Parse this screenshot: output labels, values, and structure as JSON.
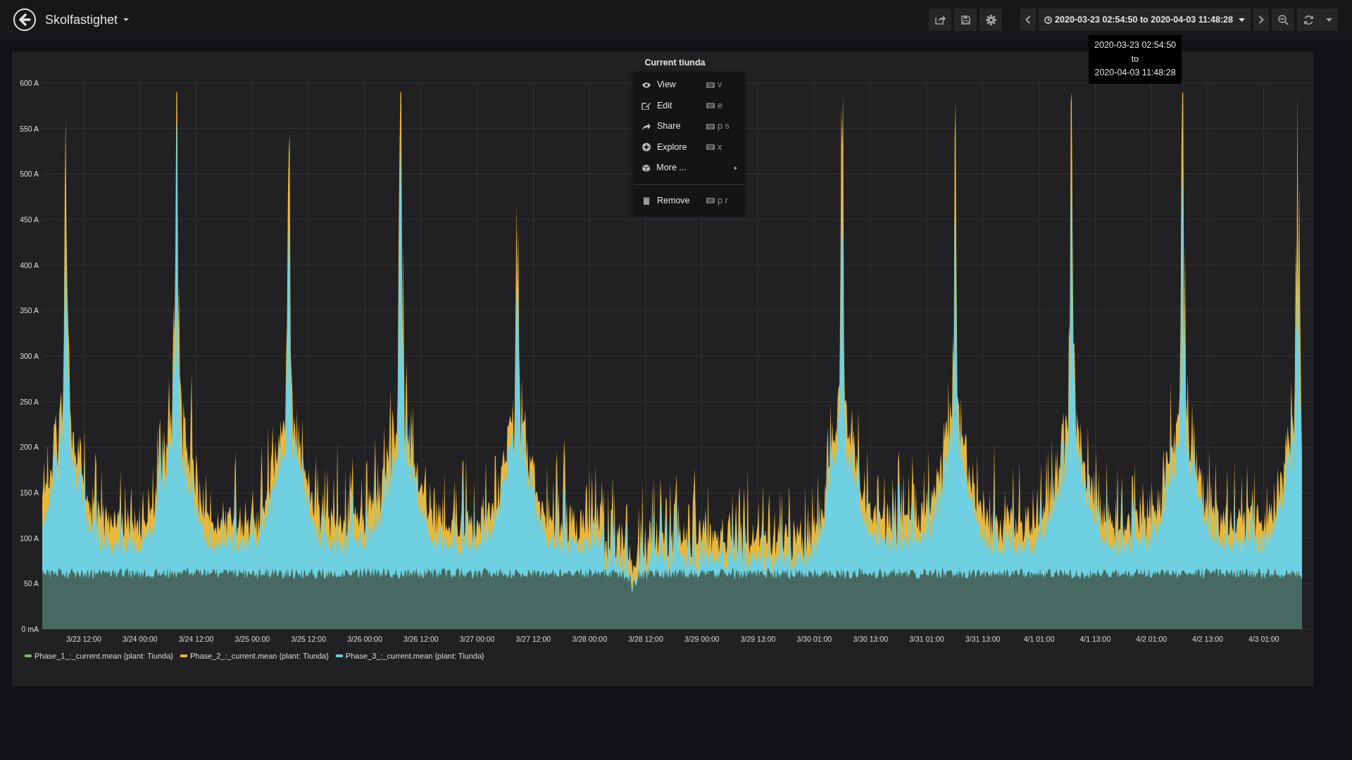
{
  "header": {
    "title": "Skolfastighet"
  },
  "time_range": {
    "label": "2020-03-23 02:54:50 to 2020-04-03 11:48:28"
  },
  "tooltip": {
    "lines": [
      "2020-03-23 02:54:50",
      "to",
      "2020-04-03 11:48:28"
    ]
  },
  "panel": {
    "title": "Current tiunda",
    "y_axis_labels": [
      "600 A",
      "550 A",
      "500 A",
      "450 A",
      "400 A",
      "350 A",
      "300 A",
      "250 A",
      "200 A",
      "150 A",
      "100 A",
      "50 A",
      "0 mA"
    ],
    "x_axis_labels": [
      "3/23 12:00",
      "3/24 00:00",
      "3/24 12:00",
      "3/25 00:00",
      "3/25 12:00",
      "3/26 00:00",
      "3/26 12:00",
      "3/27 00:00",
      "3/27 12:00",
      "3/28 00:00",
      "3/28 12:00",
      "3/29 00:00",
      "3/29 13:00",
      "3/30 01:00",
      "3/30 13:00",
      "3/31 01:00",
      "3/31 13:00",
      "4/1 01:00",
      "4/1 13:00",
      "4/2 01:00",
      "4/2 13:00",
      "4/3 01:00"
    ],
    "legend": [
      {
        "name": "Phase_1_:_current.mean {plant: Tiunda}",
        "color": "#7eb26d"
      },
      {
        "name": "Phase_2_:_current.mean {plant: Tiunda}",
        "color": "#eab839"
      },
      {
        "name": "Phase_3_:_current.mean {plant: Tiunda}",
        "color": "#6ed0e0"
      }
    ],
    "menu": [
      {
        "kind": "item",
        "label": "View",
        "shortcut": "v",
        "submenu": false
      },
      {
        "kind": "item",
        "label": "Edit",
        "shortcut": "e",
        "submenu": false
      },
      {
        "kind": "item",
        "label": "Share",
        "shortcut": "p s",
        "submenu": false
      },
      {
        "kind": "item",
        "label": "Explore",
        "shortcut": "x",
        "submenu": false
      },
      {
        "kind": "item",
        "label": "More ...",
        "submenu": true
      },
      {
        "kind": "divider"
      },
      {
        "kind": "item",
        "label": "Remove",
        "shortcut": "p r",
        "submenu": false
      }
    ]
  }
}
